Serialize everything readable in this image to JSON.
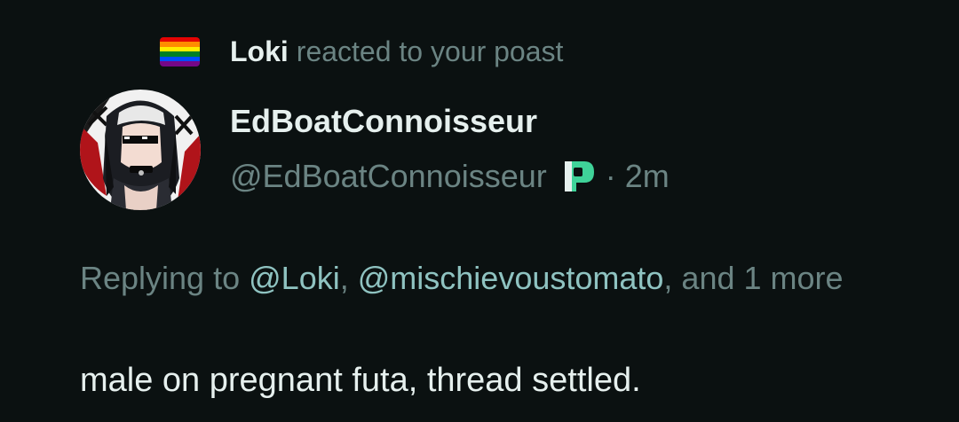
{
  "notification": {
    "actor": "Loki",
    "action_text": "reacted to your poast",
    "icon": "pride-flag-icon",
    "flag_colors": [
      "#e40303",
      "#ff8c00",
      "#ffed00",
      "#008026",
      "#004dff",
      "#750787"
    ]
  },
  "post": {
    "display_name": "EdBoatConnoisseur",
    "handle": "@EdBoatConnoisseur",
    "badge_icon": "p-badge-icon",
    "separator": "·",
    "timestamp": "2m",
    "reply": {
      "prefix": "Replying to",
      "mention1": "@Loki",
      "comma1": ",",
      "mention2": "@mischievoustomato",
      "suffix": ", and 1 more"
    },
    "text": "male on pregnant futa, thread settled."
  },
  "colors": {
    "background": "#0b1111",
    "primary_text": "#e6f0ee",
    "secondary_text": "#6b8483",
    "mention": "#8fc3c1",
    "badge_green": "#3fd399"
  }
}
